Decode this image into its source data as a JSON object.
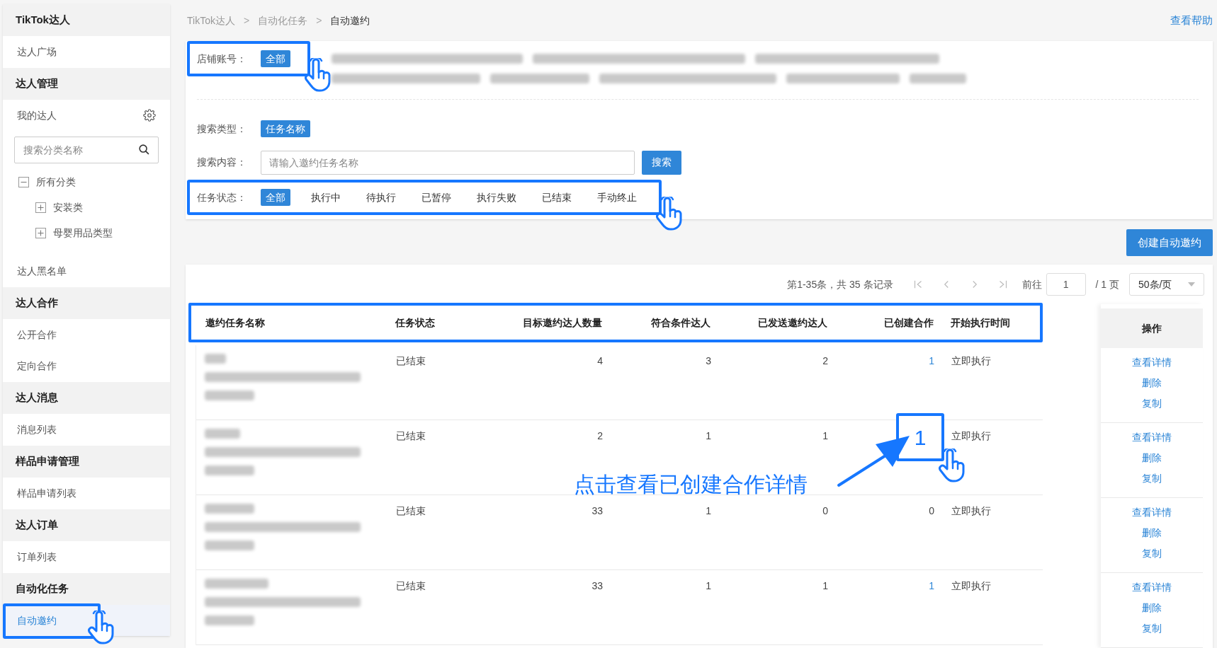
{
  "sidebar": {
    "groups": [
      {
        "title": "TikTok达人",
        "items": [
          {
            "kind": "link",
            "label": "达人广场",
            "selected": false
          }
        ]
      },
      {
        "title": "达人管理",
        "items": [
          {
            "kind": "manage",
            "label": "我的达人",
            "selected": false
          },
          {
            "kind": "search",
            "placeholder": "搜索分类名称"
          },
          {
            "kind": "tree",
            "nodes": [
              {
                "label": "所有分类",
                "expanded": true,
                "children": [
                  {
                    "label": "安装类",
                    "expanded": false
                  },
                  {
                    "label": "母婴用品类型",
                    "expanded": false
                  }
                ]
              }
            ]
          },
          {
            "kind": "link",
            "label": "达人黑名单",
            "selected": false
          }
        ]
      },
      {
        "title": "达人合作",
        "items": [
          {
            "kind": "link",
            "label": "公开合作",
            "selected": false
          },
          {
            "kind": "link",
            "label": "定向合作",
            "selected": false
          }
        ]
      },
      {
        "title": "达人消息",
        "items": [
          {
            "kind": "link",
            "label": "消息列表",
            "selected": false
          }
        ]
      },
      {
        "title": "样品申请管理",
        "items": [
          {
            "kind": "link",
            "label": "样品申请列表",
            "selected": false
          }
        ]
      },
      {
        "title": "达人订单",
        "items": [
          {
            "kind": "link",
            "label": "订单列表",
            "selected": false
          }
        ]
      },
      {
        "title": "自动化任务",
        "items": [
          {
            "kind": "link",
            "label": "自动邀约",
            "selected": true,
            "highlighted": true
          }
        ]
      }
    ]
  },
  "breadcrumb": {
    "separator": ">",
    "items": [
      "TikTok达人",
      "自动化任务",
      "自动邀约"
    ]
  },
  "help_link": "查看帮助",
  "filters": [
    {
      "kind": "chips",
      "label": "店铺账号：",
      "highlighted": true,
      "options": [
        {
          "label": "全部",
          "selected": true
        }
      ]
    },
    {
      "kind": "chips",
      "label": "搜索类型：",
      "options": [
        {
          "label": "任务名称",
          "selected": true
        }
      ]
    },
    {
      "kind": "search",
      "label": "搜索内容：",
      "placeholder": "请输入邀约任务名称",
      "button": "搜索"
    },
    {
      "kind": "chips",
      "label": "任务状态：",
      "highlighted": true,
      "options": [
        {
          "label": "全部",
          "selected": true
        },
        {
          "label": "执行中",
          "selected": false
        },
        {
          "label": "待执行",
          "selected": false
        },
        {
          "label": "已暂停",
          "selected": false
        },
        {
          "label": "执行失败",
          "selected": false
        },
        {
          "label": "已结束",
          "selected": false
        },
        {
          "label": "手动终止",
          "selected": false
        }
      ]
    }
  ],
  "create_button": "创建自动邀约",
  "pagination": {
    "summary": "第1-35条，共 35 条记录",
    "goto_label": "前往",
    "page": "1",
    "total_pages": "/ 1 页",
    "page_size": "50条/页"
  },
  "table": {
    "header_highlighted": true,
    "columns": [
      "邀约任务名称",
      "任务状态",
      "目标邀约达人数量",
      "符合条件达人",
      "已发送邀约达人",
      "已创建合作",
      "开始执行时间"
    ],
    "action_column": "操作",
    "rows": [
      {
        "status": "已结束",
        "target": "4",
        "eligible": "3",
        "sent": "2",
        "created": "1",
        "created_link": true,
        "start": "立即执行",
        "actions": [
          "查看详情",
          "删除",
          "复制"
        ]
      },
      {
        "status": "已结束",
        "target": "2",
        "eligible": "1",
        "sent": "1",
        "created": "1",
        "created_link": true,
        "created_highlighted": true,
        "start": "立即执行",
        "actions": [
          "查看详情",
          "删除",
          "复制"
        ]
      },
      {
        "status": "已结束",
        "target": "33",
        "eligible": "1",
        "sent": "0",
        "created": "0",
        "created_link": false,
        "start": "立即执行",
        "actions": [
          "查看详情",
          "删除",
          "复制"
        ]
      },
      {
        "status": "已结束",
        "target": "33",
        "eligible": "1",
        "sent": "1",
        "created": "1",
        "created_link": true,
        "start": "立即执行",
        "actions": [
          "查看详情",
          "删除",
          "复制"
        ]
      }
    ]
  },
  "annotation": {
    "text": "点击查看已创建合作详情"
  }
}
